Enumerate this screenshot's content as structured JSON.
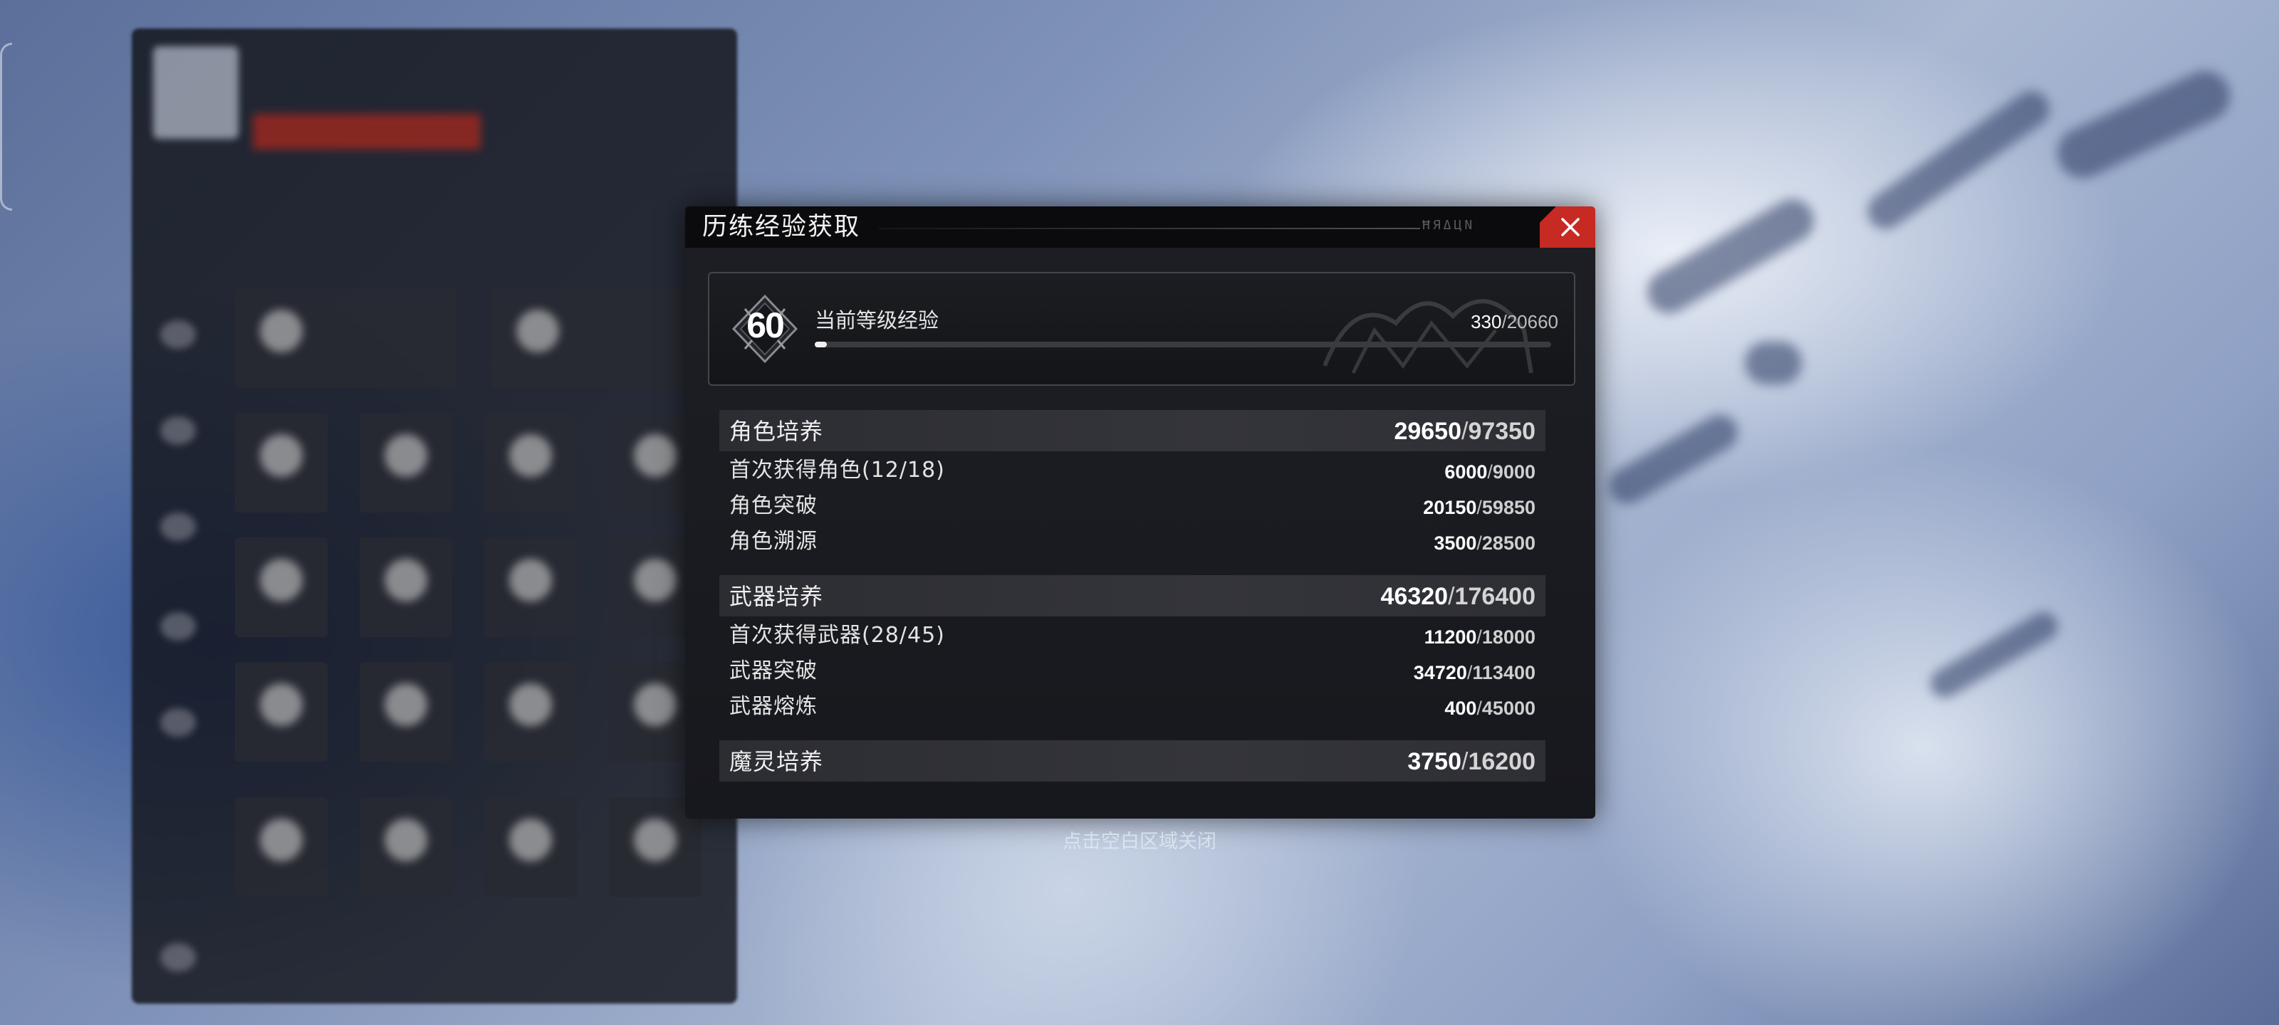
{
  "dialog": {
    "title": "历练经验获取",
    "header_deco": "ĦЯΔЦΝ",
    "level": {
      "number": "60",
      "label": "当前等级经验",
      "current": "330",
      "separator": "/",
      "total": "20660",
      "progress_fraction": 0.016
    },
    "sections": [
      {
        "name": "角色培养",
        "current": "29650",
        "separator": "/",
        "total": "97350",
        "rows": [
          {
            "name": "首次获得角色(12/18)",
            "current": "6000",
            "separator": "/",
            "total": "9000"
          },
          {
            "name": "角色突破",
            "current": "20150",
            "separator": "/",
            "total": "59850"
          },
          {
            "name": "角色溯源",
            "current": "3500",
            "separator": "/",
            "total": "28500"
          }
        ]
      },
      {
        "name": "武器培养",
        "current": "46320",
        "separator": "/",
        "total": "176400",
        "rows": [
          {
            "name": "首次获得武器(28/45)",
            "current": "11200",
            "separator": "/",
            "total": "18000"
          },
          {
            "name": "武器突破",
            "current": "34720",
            "separator": "/",
            "total": "113400"
          },
          {
            "name": "武器熔炼",
            "current": "400",
            "separator": "/",
            "total": "45000"
          }
        ]
      },
      {
        "name": "魔灵培养",
        "current": "3750",
        "separator": "/",
        "total": "16200",
        "rows": []
      }
    ]
  },
  "footer_hint": "点击空白区域关闭",
  "colors": {
    "close_button": "#c72a22",
    "dialog_bg": "#1a1b20",
    "section_bar": "#303137"
  },
  "icons": {
    "close": "close-icon",
    "level_emblem": "level-emblem-icon"
  }
}
